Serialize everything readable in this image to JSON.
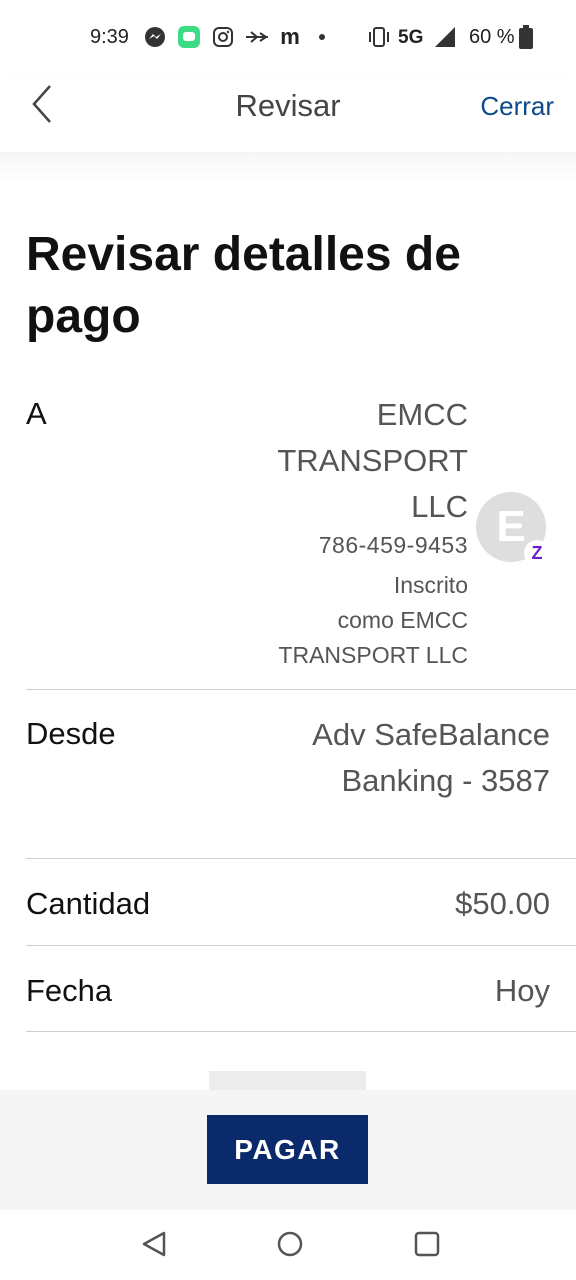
{
  "status_bar": {
    "time": "9:39",
    "network": "5G",
    "battery": "60 %",
    "icons": [
      "messenger-icon",
      "chat-icon",
      "instagram-icon",
      "airplane-wifi-icon",
      "mzone-icon",
      "dot-icon",
      "vibrate-icon",
      "signal-icon",
      "battery-icon"
    ],
    "mzone_text": "m"
  },
  "header": {
    "back_icon": "chevron-left-icon",
    "title": "Revisar",
    "close_label": "Cerrar",
    "accent_color": "#0b4a8b"
  },
  "page_title": "Revisar detalles de pago",
  "recipient": {
    "label": "A",
    "name_lines": [
      "EMCC",
      "TRANSPORT",
      "LLC"
    ],
    "phone": "786-459-9453",
    "enrolled_lines": [
      "Inscrito",
      "como EMCC",
      "TRANSPORT LLC"
    ],
    "avatar_letter": "E",
    "badge_letter": "Z"
  },
  "from": {
    "label": "Desde",
    "value_lines": [
      "Adv SafeBalance",
      "Banking - 3587"
    ]
  },
  "amount": {
    "label": "Cantidad",
    "value": "$50.00"
  },
  "date": {
    "label": "Fecha",
    "value": "Hoy"
  },
  "pay_button": {
    "label": "PAGAR",
    "color": "#0a2a6b"
  },
  "nav": {
    "icons": [
      "back-triangle-icon",
      "home-circle-icon",
      "recents-square-icon"
    ]
  }
}
